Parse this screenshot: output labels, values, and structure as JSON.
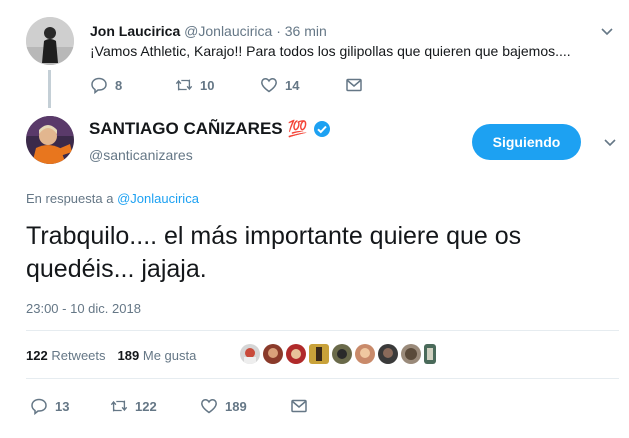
{
  "reply_tweet": {
    "name": "Jon Laucirica",
    "handle": "@Jonlaucirica",
    "separator": "·",
    "time": "36 min",
    "text": "¡Vamos Athletic, Karajo!! Para todos los gilipollas que quieren que bajemos....",
    "reply_count": "8",
    "retweet_count": "10",
    "like_count": "14"
  },
  "main_tweet": {
    "name": "SANTIAGO CAÑIZARES",
    "emoji": "💯",
    "handle": "@santicanizares",
    "follow_label": "Siguiendo",
    "reply_prefix": "En respuesta a",
    "reply_to": "@Jonlaucirica",
    "text_line1": "Trabquilo.... el más importante quiere que os",
    "text_line2": "quedéis... jajaja.",
    "timestamp": "23:00 - 10 dic. 2018",
    "retweets_value": "122",
    "retweets_label": "Retweets",
    "likes_value": "189",
    "likes_label": "Me gusta",
    "reply_count": "13",
    "retweet_count": "122",
    "like_count": "189"
  },
  "colors": {
    "accent": "#1da1f2",
    "muted": "#657786",
    "verified": "#1da1f2",
    "heart": "#657786"
  },
  "icons": [
    "reply-icon",
    "retweet-icon",
    "heart-icon",
    "dm-icon",
    "chevron-down-icon",
    "verified-badge-icon"
  ]
}
